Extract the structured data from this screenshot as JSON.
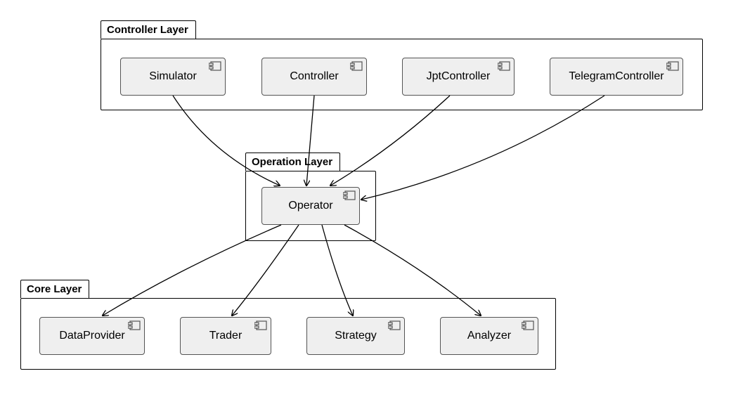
{
  "diagram": {
    "type": "uml-component-diagram",
    "layers": [
      {
        "id": "controller",
        "title": "Controller Layer",
        "components": [
          "Simulator",
          "Controller",
          "JptController",
          "TelegramController"
        ]
      },
      {
        "id": "operation",
        "title": "Operation Layer",
        "components": [
          "Operator"
        ]
      },
      {
        "id": "core",
        "title": "Core Layer",
        "components": [
          "DataProvider",
          "Trader",
          "Strategy",
          "Analyzer"
        ]
      }
    ],
    "dependencies": [
      {
        "from": "Simulator",
        "to": "Operator"
      },
      {
        "from": "Controller",
        "to": "Operator"
      },
      {
        "from": "JptController",
        "to": "Operator"
      },
      {
        "from": "TelegramController",
        "to": "Operator"
      },
      {
        "from": "Operator",
        "to": "DataProvider"
      },
      {
        "from": "Operator",
        "to": "Trader"
      },
      {
        "from": "Operator",
        "to": "Strategy"
      },
      {
        "from": "Operator",
        "to": "Analyzer"
      }
    ]
  }
}
